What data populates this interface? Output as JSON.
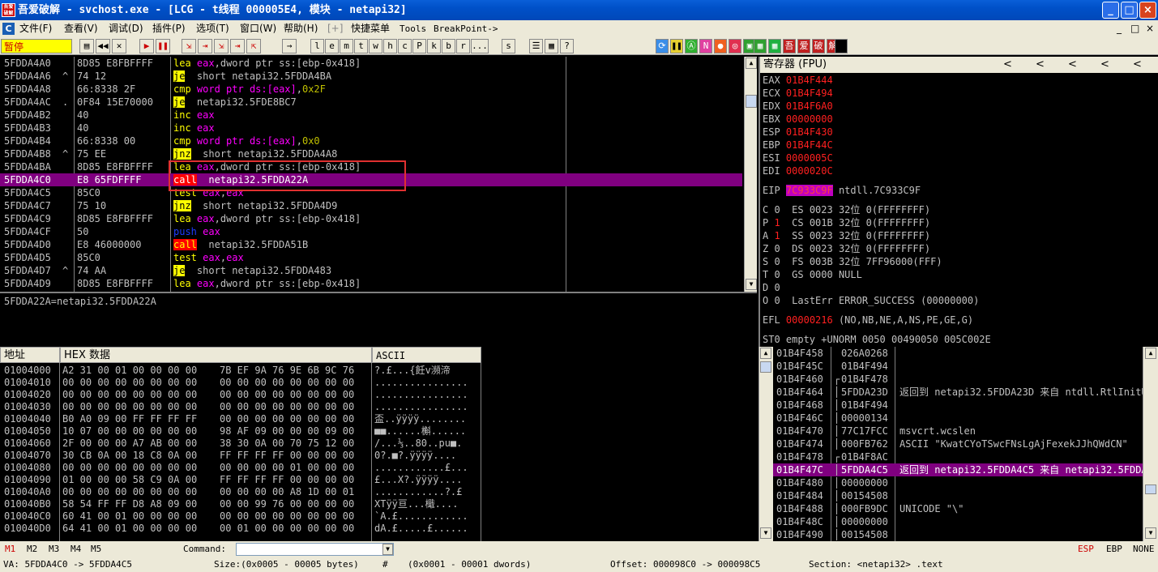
{
  "window": {
    "title": "吾爱破解 - svchost.exe - [LCG - t线程   000005E4, 模块 - netapi32]",
    "app_icon_text": "吾爱破解",
    "minimize": "_",
    "maximize": "□",
    "close": "×"
  },
  "menu": {
    "items": [
      "文件(F)",
      "查看(V)",
      "调试(D)",
      "插件(P)",
      "选项(T)",
      "窗口(W)",
      "帮助(H)",
      "[+]",
      "快捷菜单",
      "Tools",
      "BreakPoint->"
    ],
    "right_controls": [
      "_",
      "□",
      "×"
    ]
  },
  "toolbar": {
    "status": "暂停",
    "letters": [
      "l",
      "e",
      "m",
      "t",
      "w",
      "h",
      "c",
      "P",
      "k",
      "b",
      "r",
      "...",
      "s"
    ],
    "plugin_buttons": [
      "吾",
      "爱",
      "破",
      "解"
    ]
  },
  "disasm": {
    "rows": [
      {
        "addr": "5FDDA4A0",
        "mark": " ",
        "hex": "8D85 E8FBFFFF",
        "op": "lea",
        "args": [
          [
            "reg",
            "eax"
          ],
          [
            "t",
            ","
          ],
          [
            "t",
            "dword ptr ss:[ebp-0x418]"
          ]
        ],
        "sel": false
      },
      {
        "addr": "5FDDA4A6",
        "mark": "^",
        "hex": "74 12",
        "op": "je",
        "opstyle": "kwj",
        "args": [
          [
            "t",
            " short netapi32.5FDDA4BA"
          ]
        ],
        "sel": false
      },
      {
        "addr": "5FDDA4A8",
        "mark": " ",
        "hex": "66:8338 2F",
        "op": "cmp",
        "args": [
          [
            "mem",
            "word ptr ds:[eax]"
          ],
          [
            "t",
            ","
          ],
          [
            "num",
            "0x2F"
          ]
        ],
        "sel": false
      },
      {
        "addr": "5FDDA4AC",
        "mark": ".",
        "hex": "0F84 15E70000",
        "op": "je",
        "opstyle": "kwj",
        "args": [
          [
            "t",
            " netapi32.5FDE8BC7"
          ]
        ],
        "sel": false
      },
      {
        "addr": "5FDDA4B2",
        "mark": " ",
        "hex": "40",
        "op": "inc",
        "args": [
          [
            "reg",
            "eax"
          ]
        ],
        "sel": false
      },
      {
        "addr": "5FDDA4B3",
        "mark": " ",
        "hex": "40",
        "op": "inc",
        "args": [
          [
            "reg",
            "eax"
          ]
        ],
        "sel": false
      },
      {
        "addr": "5FDDA4B4",
        "mark": " ",
        "hex": "66:8338 00",
        "op": "cmp",
        "args": [
          [
            "mem",
            "word ptr ds:[eax]"
          ],
          [
            "t",
            ","
          ],
          [
            "num",
            "0x0"
          ]
        ],
        "sel": false
      },
      {
        "addr": "5FDDA4B8",
        "mark": "^",
        "hex": "75 EE",
        "op": "jnz",
        "opstyle": "kwj",
        "args": [
          [
            "t",
            " short netapi32.5FDDA4A8"
          ]
        ],
        "sel": false
      },
      {
        "addr": "5FDDA4BA",
        "mark": " ",
        "hex": "8D85 E8FBFFFF",
        "op": "lea",
        "args": [
          [
            "reg",
            "eax"
          ],
          [
            "t",
            ","
          ],
          [
            "t",
            "dword ptr ss:[ebp-0x418]"
          ]
        ],
        "sel": false
      },
      {
        "addr": "5FDDA4C0",
        "mark": " ",
        "hex": "E8 65FDFFFF",
        "op": "call",
        "opstyle": "kwc",
        "args": [
          [
            "t",
            " netapi32.5FDDA22A"
          ]
        ],
        "sel": true
      },
      {
        "addr": "5FDDA4C5",
        "mark": " ",
        "hex": "85C0",
        "op": "test",
        "args": [
          [
            "reg",
            "eax"
          ],
          [
            "t",
            ","
          ],
          [
            "reg",
            "eax"
          ]
        ],
        "sel": false
      },
      {
        "addr": "5FDDA4C7",
        "mark": " ",
        "hex": "75 10",
        "op": "jnz",
        "opstyle": "kwj",
        "args": [
          [
            "t",
            " short netapi32.5FDDA4D9"
          ]
        ],
        "sel": false
      },
      {
        "addr": "5FDDA4C9",
        "mark": " ",
        "hex": "8D85 E8FBFFFF",
        "op": "lea",
        "args": [
          [
            "reg",
            "eax"
          ],
          [
            "t",
            ","
          ],
          [
            "t",
            "dword ptr ss:[ebp-0x418]"
          ]
        ],
        "sel": false
      },
      {
        "addr": "5FDDA4CF",
        "mark": " ",
        "hex": "50",
        "op": "push",
        "opstyle": "kwp",
        "args": [
          [
            "reg",
            "eax"
          ]
        ],
        "sel": false
      },
      {
        "addr": "5FDDA4D0",
        "mark": " ",
        "hex": "E8 46000000",
        "op": "call",
        "opstyle": "kwc",
        "args": [
          [
            "t",
            " netapi32.5FDDA51B"
          ]
        ],
        "sel": false
      },
      {
        "addr": "5FDDA4D5",
        "mark": " ",
        "hex": "85C0",
        "op": "test",
        "args": [
          [
            "reg",
            "eax"
          ],
          [
            "t",
            ","
          ],
          [
            "reg",
            "eax"
          ]
        ],
        "sel": false
      },
      {
        "addr": "5FDDA4D7",
        "mark": "^",
        "hex": "74 AA",
        "op": "je",
        "opstyle": "kwj",
        "args": [
          [
            "t",
            " short netapi32.5FDDA483"
          ]
        ],
        "sel": false
      },
      {
        "addr": "5FDDA4D9",
        "mark": " ",
        "hex": "8D85 E8FBFFFF",
        "op": "lea",
        "args": [
          [
            "reg",
            "eax"
          ],
          [
            "t",
            ","
          ],
          [
            "t",
            "dword ptr ss:[ebp-0x418]"
          ]
        ],
        "sel": false
      }
    ],
    "info": "5FDDA22A=netapi32.5FDDA22A"
  },
  "registers": {
    "header": "寄存器 (FPU)",
    "arrows": [
      "<",
      "<",
      "<",
      "<",
      "<"
    ],
    "gp": [
      {
        "name": "EAX",
        "value": "01B4F444"
      },
      {
        "name": "ECX",
        "value": "01B4F494"
      },
      {
        "name": "EDX",
        "value": "01B4F6A0"
      },
      {
        "name": "EBX",
        "value": "00000000"
      },
      {
        "name": "ESP",
        "value": "01B4F430"
      },
      {
        "name": "EBP",
        "value": "01B4F44C"
      },
      {
        "name": "ESI",
        "value": "0000005C"
      },
      {
        "name": "EDI",
        "value": "0000020C"
      }
    ],
    "eip": {
      "name": "EIP",
      "value": "7C933C9F",
      "desc": "ntdll.7C933C9F"
    },
    "flags": [
      {
        "f": "C",
        "v": "0",
        "seg": "ES 0023 32位 0(FFFFFFFF)",
        "red": false
      },
      {
        "f": "P",
        "v": "1",
        "seg": "CS 001B 32位 0(FFFFFFFF)",
        "red": true
      },
      {
        "f": "A",
        "v": "1",
        "seg": "SS 0023 32位 0(FFFFFFFF)",
        "red": true
      },
      {
        "f": "Z",
        "v": "0",
        "seg": "DS 0023 32位 0(FFFFFFFF)",
        "red": false
      },
      {
        "f": "S",
        "v": "0",
        "seg": "FS 003B 32位 7FF96000(FFF)",
        "red": false
      },
      {
        "f": "T",
        "v": "0",
        "seg": "GS 0000 NULL",
        "red": false
      },
      {
        "f": "D",
        "v": "0",
        "seg": "",
        "red": false
      },
      {
        "f": "O",
        "v": "0",
        "seg": "LastErr ERROR_SUCCESS (00000000)",
        "red": false
      }
    ],
    "efl": {
      "name": "EFL",
      "value": "00000216",
      "desc": "(NO,NB,NE,A,NS,PE,GE,G)"
    },
    "st0": "ST0 empty +UNORM 0050 00490050 005C002E"
  },
  "dump": {
    "headers": {
      "addr": "地址",
      "hex": "HEX 数据",
      "ascii": "ASCII"
    },
    "rows": [
      {
        "addr": "01004000",
        "hex": "A2 31 00 01 00 00 00 00 7B EF 9A 76 9E 6B 9C 76",
        "ascii": "?.£...{飪v瀕渧"
      },
      {
        "addr": "01004010",
        "hex": "00 00 00 00 00 00 00 00 00 00 00 00 00 00 00 00",
        "ascii": "................"
      },
      {
        "addr": "01004020",
        "hex": "00 00 00 00 00 00 00 00 00 00 00 00 00 00 00 00",
        "ascii": "................"
      },
      {
        "addr": "01004030",
        "hex": "00 00 00 00 00 00 00 00 00 00 00 00 00 00 00 00",
        "ascii": "................"
      },
      {
        "addr": "01004040",
        "hex": "B0 A0 09 00 FF FF FF FF 00 00 00 00 00 00 00 00",
        "ascii": "盃..ÿÿÿÿ........"
      },
      {
        "addr": "01004050",
        "hex": "10 07 00 00 00 00 00 00 98 AF 09 00 00 00 09 00",
        "ascii": "■■......槲......"
      },
      {
        "addr": "01004060",
        "hex": "2F 00 00 00 A7 AB 00 00 38 30 0A 00 70 75 12 00",
        "ascii": "/...⅓..80..pu■."
      },
      {
        "addr": "01004070",
        "hex": "30 CB 0A 00 18 C8 0A 00 FF FF FF FF 00 00 00 00",
        "ascii": "0?.■?.ÿÿÿÿ...."
      },
      {
        "addr": "01004080",
        "hex": "00 00 00 00 00 00 00 00 00 00 00 00 01 00 00 00",
        "ascii": "............£..."
      },
      {
        "addr": "01004090",
        "hex": "01 00 00 00 58 C9 0A 00 FF FF FF FF 00 00 00 00",
        "ascii": "£...X?.ÿÿÿÿ...."
      },
      {
        "addr": "010040A0",
        "hex": "00 00 00 00 00 00 00 00 00 00 00 00 A8 1D 00 01",
        "ascii": "............?.£"
      },
      {
        "addr": "010040B0",
        "hex": "58 54 FF FF D8 A8 09 00 00 00 99 76 00 00 00 00",
        "ascii": "XTÿÿ亘...檝...."
      },
      {
        "addr": "010040C0",
        "hex": "60 41 00 01 00 00 00 00 00 00 00 00 00 00 00 00",
        "ascii": "`A.£............"
      },
      {
        "addr": "010040D0",
        "hex": "64 41 00 01 00 00 00 00 00 01 00 00 00 00 00 00",
        "ascii": "dA.£.....£......"
      }
    ]
  },
  "stack": {
    "rows": [
      {
        "addr": "01B4F458",
        "mark": " ",
        "val": "026A0268",
        "cmt": "",
        "sel": false
      },
      {
        "addr": "01B4F45C",
        "mark": " ",
        "val": "01B4F494",
        "cmt": "",
        "sel": false
      },
      {
        "addr": "01B4F460",
        "mark": "┌",
        "val": "01B4F478",
        "cmt": "",
        "sel": false
      },
      {
        "addr": "01B4F464",
        "mark": "│",
        "val": "5FDDA23D",
        "cmt": "返回到 netapi32.5FDDA23D 来自 ntdll.RtlInitUnicodeString",
        "sel": false
      },
      {
        "addr": "01B4F468",
        "mark": "│",
        "val": "01B4F494",
        "cmt": "",
        "sel": false
      },
      {
        "addr": "01B4F46C",
        "mark": "│",
        "val": "00000134",
        "cmt": "",
        "sel": false
      },
      {
        "addr": "01B4F470",
        "mark": "│",
        "val": "77C17FCC",
        "cmt": "msvcrt.wcslen",
        "sel": false
      },
      {
        "addr": "01B4F474",
        "mark": "│",
        "val": "000FB762",
        "cmt": "ASCII \"KwatCYoTSwcFNsLgAjFexekJJhQWdCN\"",
        "sel": false
      },
      {
        "addr": "01B4F478",
        "mark": "┌",
        "val": "01B4F8AC",
        "cmt": "",
        "sel": false
      },
      {
        "addr": "01B4F47C",
        "mark": "│",
        "val": "5FDDA4C5",
        "cmt": "返回到 netapi32.5FDDA4C5 来自 netapi32.5FDDA22A",
        "sel": true
      },
      {
        "addr": "01B4F480",
        "mark": "│",
        "val": "00000000",
        "cmt": "",
        "sel": false
      },
      {
        "addr": "01B4F484",
        "mark": "│",
        "val": "00154508",
        "cmt": "",
        "sel": false
      },
      {
        "addr": "01B4F488",
        "mark": "│",
        "val": "000FB9DC",
        "cmt": "UNICODE \"\\\"",
        "sel": false
      },
      {
        "addr": "01B4F48C",
        "mark": "│",
        "val": "00000000",
        "cmt": "",
        "sel": false
      },
      {
        "addr": "01B4F490",
        "mark": "│",
        "val": "00154508",
        "cmt": "",
        "sel": false
      }
    ]
  },
  "command": {
    "tabs": [
      "M1",
      "M2",
      "M3",
      "M4",
      "M5"
    ],
    "label": "Command:",
    "value": "",
    "right": [
      "ESP",
      "EBP",
      "NONE"
    ]
  },
  "status": {
    "va": "VA: 5FDDA4C0 -> 5FDDA4C5",
    "size": "Size:(0x0005 - 00005 bytes)",
    "hash": "#",
    "dwords": "(0x0001 - 00001 dwords)",
    "offset": "Offset: 000098C0 -> 000098C5",
    "section": "Section: <netapi32> .text"
  },
  "colors": {
    "selection": "#800080",
    "highlight_box": "#e03030",
    "title": "#0050c8"
  }
}
